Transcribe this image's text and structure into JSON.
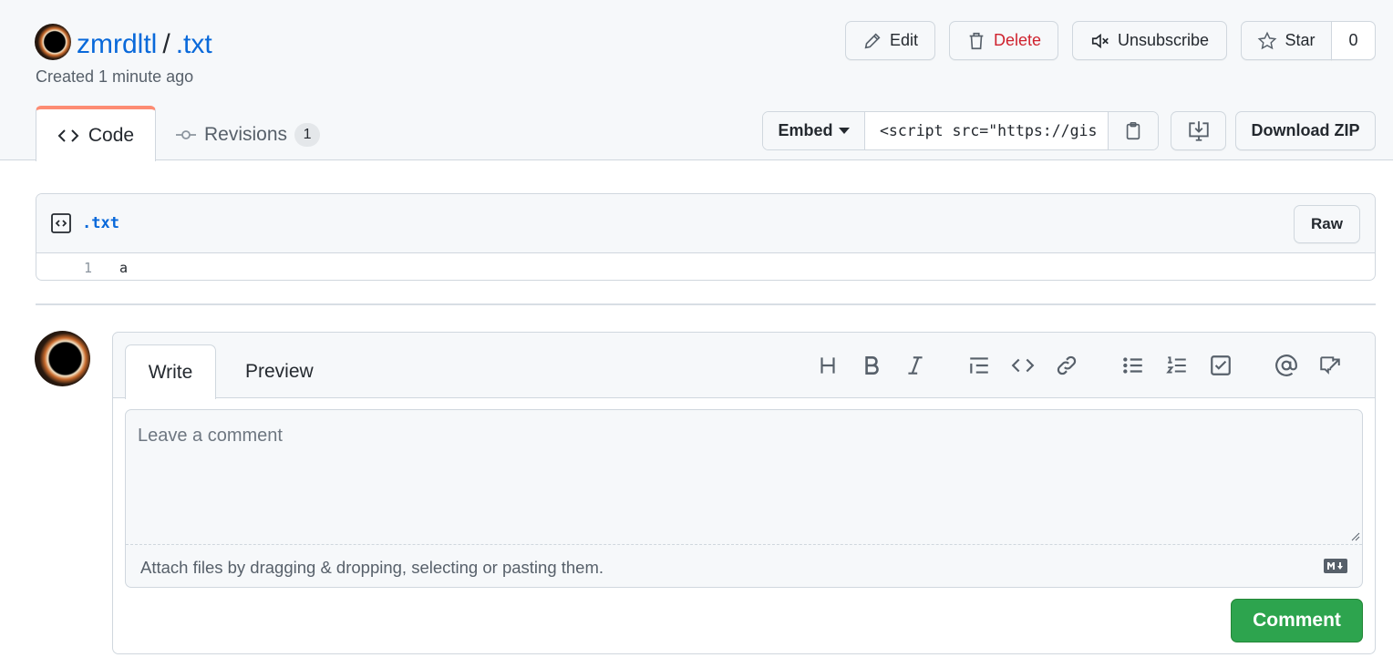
{
  "header": {
    "owner": "zmrdltl",
    "separator": "/",
    "filename": ".txt",
    "created": "Created 1 minute ago"
  },
  "actions": {
    "edit": "Edit",
    "delete": "Delete",
    "unsubscribe": "Unsubscribe",
    "star": "Star",
    "star_count": "0"
  },
  "tabs": {
    "code": "Code",
    "revisions": "Revisions",
    "revisions_count": "1"
  },
  "embed": {
    "label": "Embed",
    "value": "<script src=\"https://gis"
  },
  "download_zip": "Download ZIP",
  "file": {
    "name": ".txt",
    "raw_label": "Raw",
    "lines": [
      {
        "number": "1",
        "text": "a"
      }
    ]
  },
  "comment": {
    "write_tab": "Write",
    "preview_tab": "Preview",
    "placeholder": "Leave a comment",
    "attach_hint": "Attach files by dragging & dropping, selecting or pasting them.",
    "submit": "Comment",
    "toolbar": [
      "heading-icon",
      "bold-icon",
      "italic-icon",
      "quote-icon",
      "code-icon",
      "link-icon",
      "bulleted-list-icon",
      "numbered-list-icon",
      "task-list-icon",
      "mention-icon",
      "reference-icon"
    ]
  },
  "colors": {
    "link": "#0969da",
    "danger": "#cf222e",
    "primary": "#2da44e",
    "tab_accent": "#fd8c73"
  }
}
